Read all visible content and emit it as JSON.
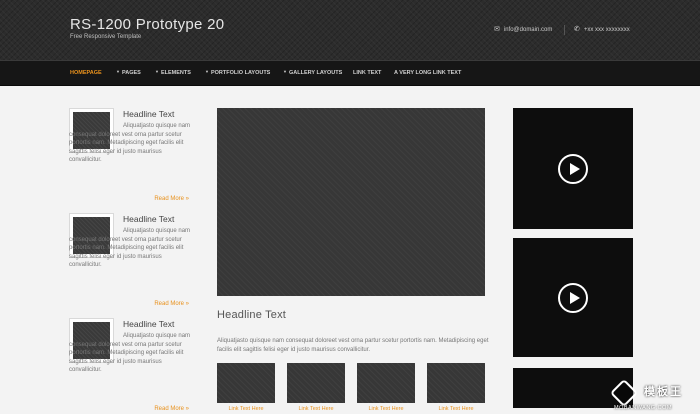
{
  "header": {
    "title": "RS-1200 Prototype 20",
    "tagline": "Free Responsive Template",
    "email": "info@domain.com",
    "phone": "+xx xxx xxxxxxxx",
    "email_icon": "envelope-icon",
    "phone_icon": "phone-icon"
  },
  "nav": {
    "items": [
      {
        "label": "Homepage",
        "dropdown": false
      },
      {
        "label": "Pages",
        "dropdown": true
      },
      {
        "label": "Elements",
        "dropdown": true
      },
      {
        "label": "Portfolio Layouts",
        "dropdown": true
      },
      {
        "label": "Gallery Layouts",
        "dropdown": true
      },
      {
        "label": "Link Text",
        "dropdown": false
      },
      {
        "label": "A Very Long Link Text",
        "dropdown": false
      }
    ],
    "active_color": "#e8911c"
  },
  "posts": [
    {
      "title": "Headline Text",
      "text": "Aliquatjasto quisque nam consequat doloreet vest orna partur scetur portortis nam. Metadipiscing eget facilis elit sagittis felisi eger id justo maurisus convallicitur.",
      "more": "Read More »"
    },
    {
      "title": "Headline Text",
      "text": "Aliquatjasto quisque nam consequat doloreet vest orna partur scetur portortis nam. Metadipiscing eget facilis elit sagittis felisi eger id justo maurisus convallicitur.",
      "more": "Read More »"
    },
    {
      "title": "Headline Text",
      "text": "Aliquatjasto quisque nam consequat doloreet vest orna partur scetur portortis nam. Metadipiscing eget facilis elit sagittis felisi eger id justo maurisus convallicitur.",
      "more": "Read More »"
    }
  ],
  "main": {
    "headline": "Headline Text",
    "text": "Aliquatjasto quisque nam consequat doloreet vest orna partur scetur portortis nam. Metadipiscing eget facilis elit sagittis felisi eger id justo maurisus convallicitur.",
    "gallery": [
      {
        "link": "Link Text Here"
      },
      {
        "link": "Link Text Here"
      },
      {
        "link": "Link Text Here"
      },
      {
        "link": "Link Text Here"
      }
    ]
  },
  "sidebar": {
    "video_icon": "play-icon"
  },
  "watermark": {
    "cn": "模板王",
    "en": "MOBANWANG.COM",
    "logo_icon": "watermark-logo-icon"
  }
}
